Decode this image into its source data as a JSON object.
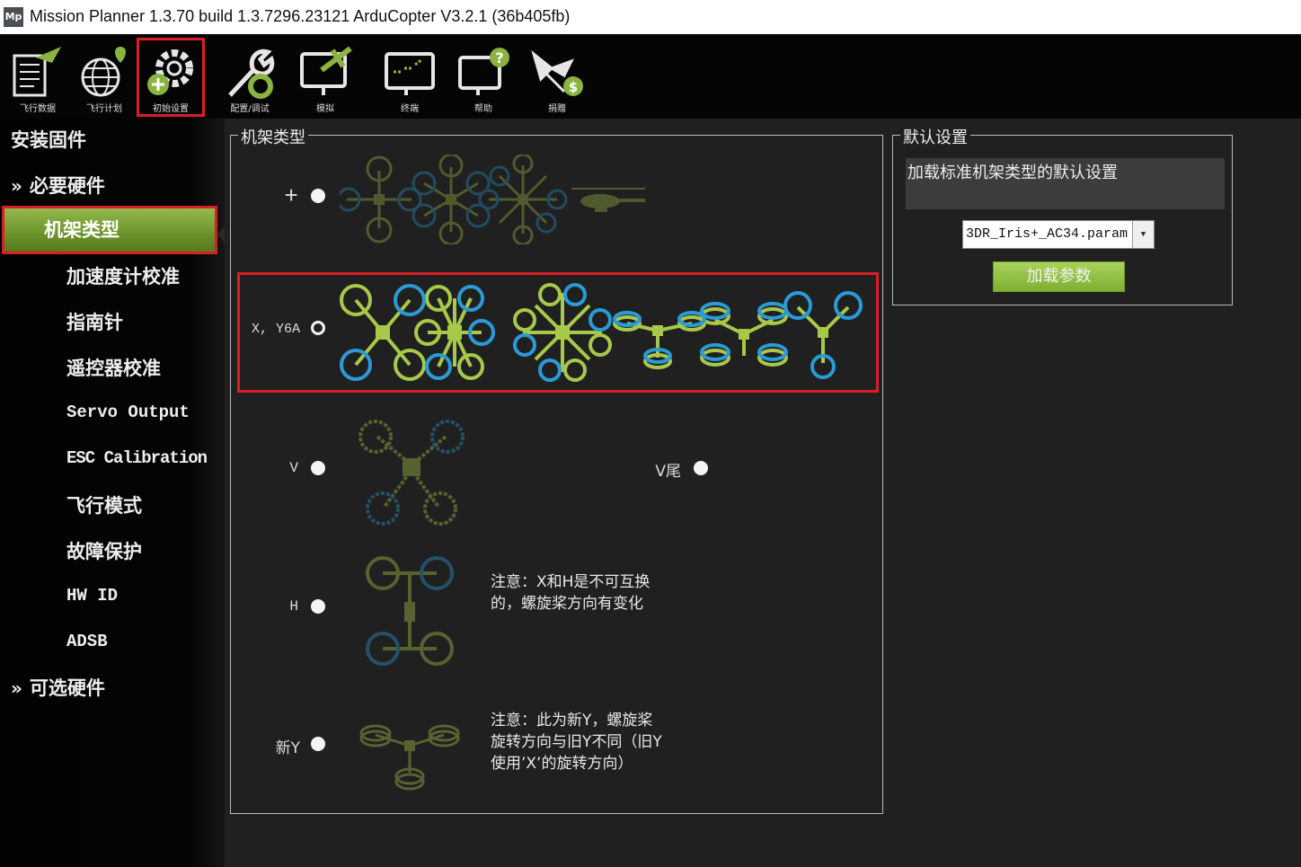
{
  "window": {
    "title": "Mission Planner 1.3.70 build 1.3.7296.23121 ArduCopter V3.2.1 (36b405fb)",
    "app_icon_text": "Mp"
  },
  "toolbar": {
    "items": [
      {
        "label": "飞行数据",
        "icon": "flight-data-icon"
      },
      {
        "label": "飞行计划",
        "icon": "flight-plan-icon"
      },
      {
        "label": "初始设置",
        "icon": "initial-setup-icon",
        "selected": true
      },
      {
        "label": "配置/调试",
        "icon": "config-tuning-icon"
      },
      {
        "label": "模拟",
        "icon": "simulation-icon"
      },
      {
        "label": "终端",
        "icon": "terminal-icon"
      },
      {
        "label": "帮助",
        "icon": "help-icon"
      },
      {
        "label": "捐赠",
        "icon": "donate-icon"
      }
    ]
  },
  "sidebar": {
    "items": [
      {
        "label": "安装固件",
        "level": 0
      },
      {
        "label": "必要硬件",
        "level": 0,
        "arrow": "»"
      },
      {
        "label": "机架类型",
        "level": 1,
        "selected": true
      },
      {
        "label": "加速度计校准",
        "level": 1
      },
      {
        "label": "指南针",
        "level": 1
      },
      {
        "label": "遥控器校准",
        "level": 1
      },
      {
        "label": "Servo Output",
        "level": 1
      },
      {
        "label": "ESC Calibration",
        "level": 1
      },
      {
        "label": "飞行模式",
        "level": 1
      },
      {
        "label": "故障保护",
        "level": 1
      },
      {
        "label": "HW ID",
        "level": 1
      },
      {
        "label": "ADSB",
        "level": 1
      },
      {
        "label": "可选硬件",
        "level": 0,
        "arrow": "»"
      }
    ]
  },
  "frame_type": {
    "title": "机架类型",
    "options": [
      {
        "label": "+",
        "selected": false
      },
      {
        "label": "X, Y6A",
        "selected": true
      },
      {
        "label": "V",
        "selected": false
      },
      {
        "label": "V尾",
        "selected": false
      },
      {
        "label": "H",
        "selected": false
      },
      {
        "label": "新Y",
        "selected": false
      }
    ],
    "note_h": [
      "注意：X和H是不可互换",
      "的，螺旋桨方向有变化"
    ],
    "note_y": [
      "注意：此为新Y，螺旋桨",
      "旋转方向与旧Y不同（旧Y",
      "使用’X’的旋转方向）"
    ]
  },
  "defaults": {
    "title": "默认设置",
    "description": "加载标准机架类型的默认设置",
    "selected_param": "3DR_Iris+_AC34.param",
    "load_button": "加载参数"
  },
  "colors": {
    "accent_green": "#8ab33f",
    "prop_green": "#a8c84a",
    "prop_blue": "#2a9bd6",
    "highlight_red": "#d81e26"
  }
}
